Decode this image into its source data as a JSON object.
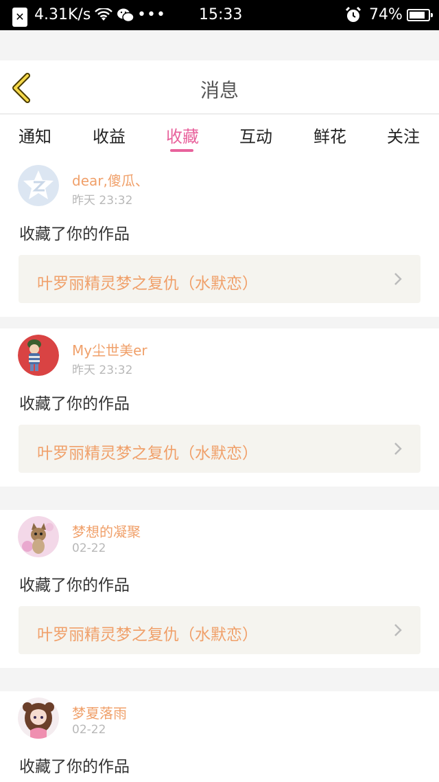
{
  "status_bar": {
    "notification_icon": "close-box-icon",
    "speed": "4.31K/s",
    "wifi_icon": "wifi-icon",
    "wechat_icon": "wechat-icon",
    "more": "•••",
    "time": "15:33",
    "alarm_icon": "alarm-icon",
    "battery": "74%"
  },
  "header": {
    "back_icon": "chevron-left-icon",
    "title": "消息"
  },
  "tabs": [
    {
      "label": "通知"
    },
    {
      "label": "收益"
    },
    {
      "label": "收藏",
      "active": true
    },
    {
      "label": "互动"
    },
    {
      "label": "鲜花"
    },
    {
      "label": "关注"
    }
  ],
  "colors": {
    "accent": "#e8629c",
    "username": "#f0a06a",
    "work_title": "#f0a06a",
    "work_bg": "#f5f4ef"
  },
  "feed": [
    {
      "username": "dear,傻瓜、",
      "time": "昨天 23:32",
      "action": "收藏了你的作品",
      "work_title": "叶罗丽精灵梦之复仇（水默恋）",
      "avatar": "qzone-avatar"
    },
    {
      "username": "My尘世美er",
      "time": "昨天 23:32",
      "action": "收藏了你的作品",
      "work_title": "叶罗丽精灵梦之复仇（水默恋）",
      "avatar": "boy-avatar"
    },
    {
      "username": "梦想的凝聚",
      "time": "02-22",
      "action": "收藏了你的作品",
      "work_title": "叶罗丽精灵梦之复仇（水默恋）",
      "avatar": "cat-avatar"
    },
    {
      "username": "梦夏落雨",
      "time": "02-22",
      "action": "收藏了你的作品",
      "work_title": "",
      "avatar": "girl-avatar"
    }
  ]
}
